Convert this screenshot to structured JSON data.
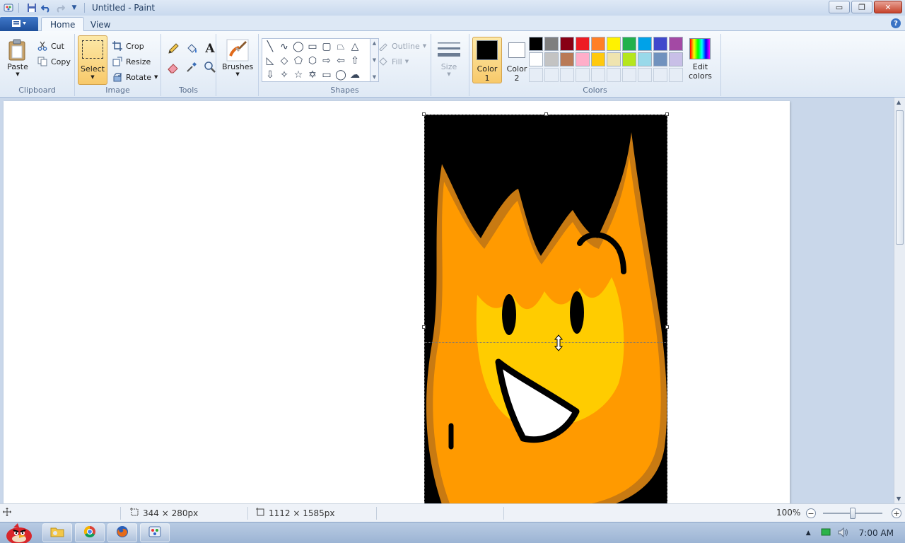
{
  "window": {
    "title": "Untitled - Paint",
    "minimize": "▭",
    "restore": "❐",
    "close": "✕"
  },
  "tabs": [
    {
      "label": "Home",
      "active": true
    },
    {
      "label": "View",
      "active": false
    }
  ],
  "clipboard": {
    "group_label": "Clipboard",
    "paste": "Paste",
    "cut": "Cut",
    "copy": "Copy"
  },
  "image": {
    "group_label": "Image",
    "select": "Select",
    "crop": "Crop",
    "resize": "Resize",
    "rotate": "Rotate"
  },
  "tools": {
    "group_label": "Tools"
  },
  "brushes": {
    "label": "Brushes"
  },
  "shapes": {
    "group_label": "Shapes",
    "outline": "Outline",
    "fill": "Fill"
  },
  "size": {
    "label": "Size"
  },
  "colors": {
    "group_label": "Colors",
    "color1_line1": "Color",
    "color1_line2": "1",
    "color2_line1": "Color",
    "color2_line2": "2",
    "edit_line1": "Edit",
    "edit_line2": "colors",
    "color1": "#000000",
    "color2": "#ffffff",
    "palette": [
      "#000000",
      "#7f7f7f",
      "#880015",
      "#ed1c24",
      "#ff7f27",
      "#fff200",
      "#22b14c",
      "#00a2e8",
      "#3f48cc",
      "#a349a4",
      "#ffffff",
      "#c3c3c3",
      "#b97a57",
      "#ffaec9",
      "#ffc90e",
      "#efe4b0",
      "#b5e61d",
      "#99d9ea",
      "#7092be",
      "#c8bfe7"
    ]
  },
  "status": {
    "selection_size": "344 × 280px",
    "image_size": "1112 × 1585px",
    "zoom": "100%"
  },
  "taskbar": {
    "time": "7:00 AM"
  }
}
